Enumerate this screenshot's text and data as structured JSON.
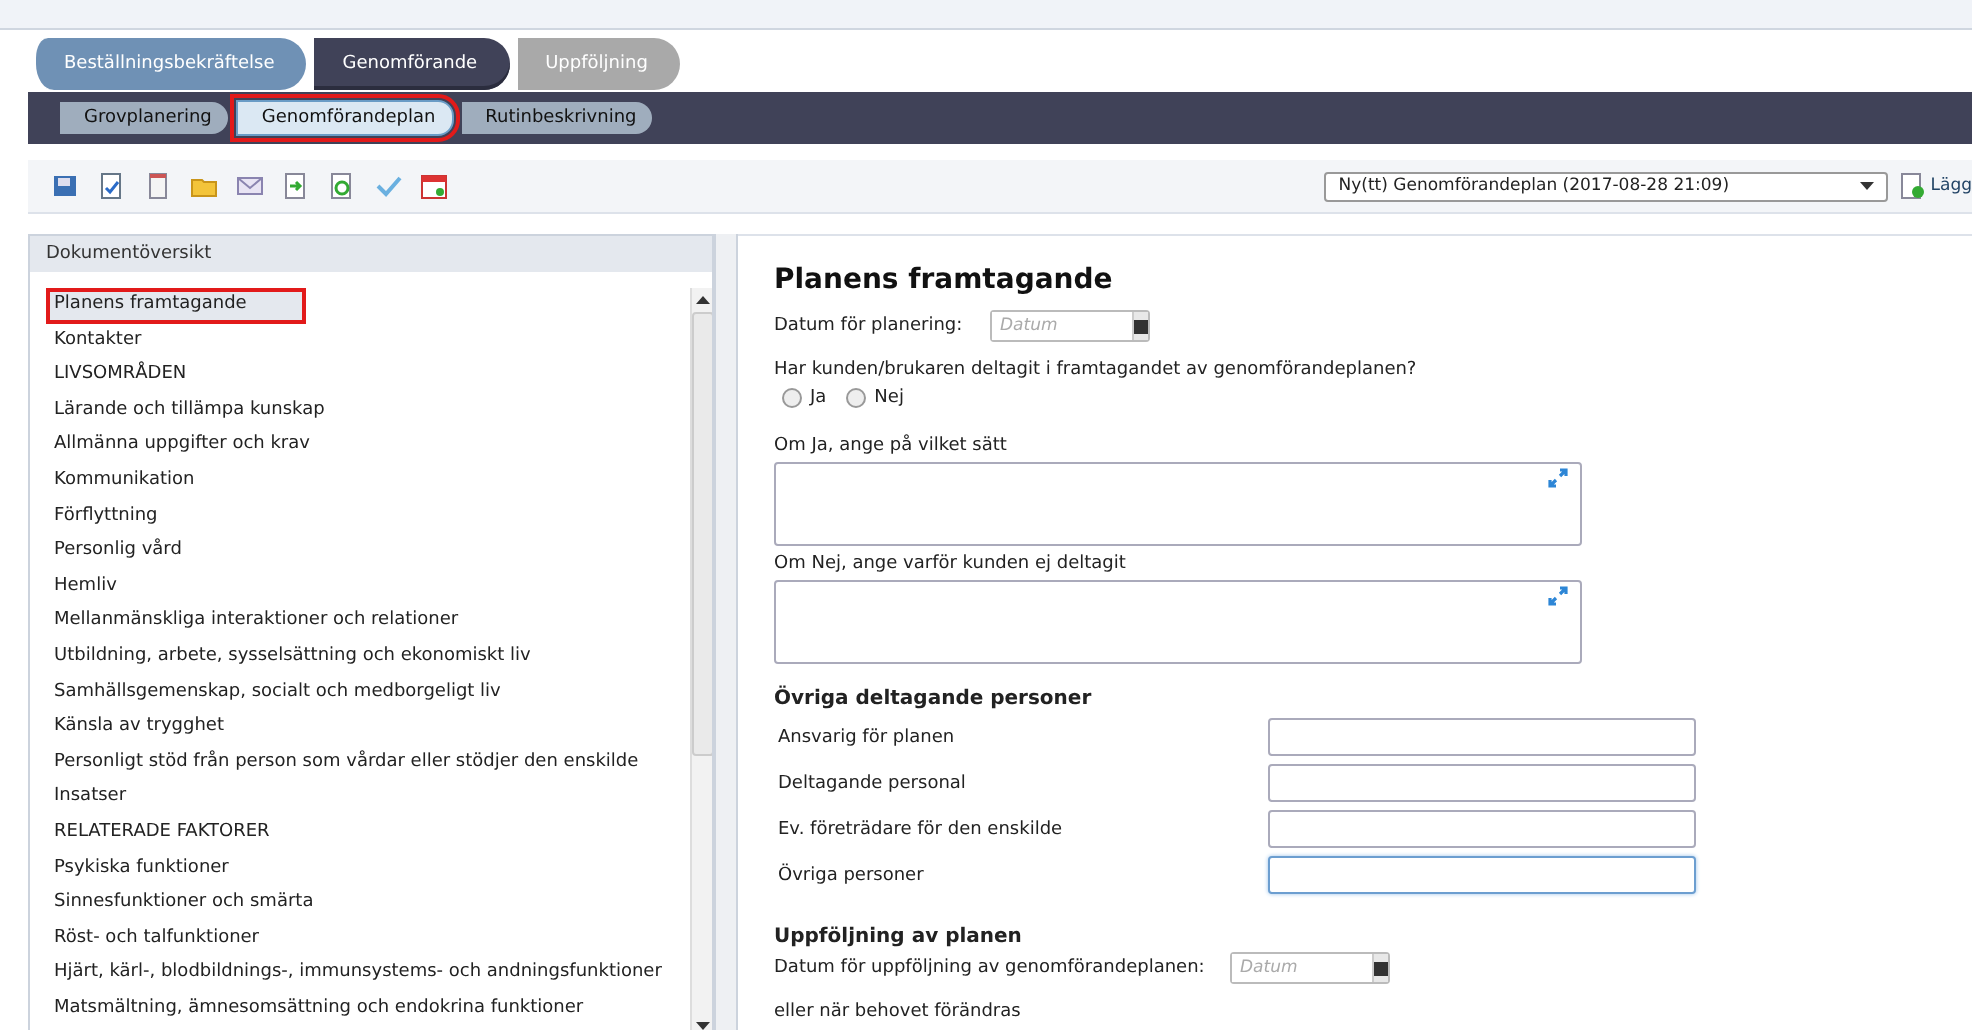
{
  "stage_tabs": [
    {
      "label": "Beställningsbekräftelse",
      "kind": "done",
      "selected": false
    },
    {
      "label": "Genomförande",
      "kind": "current",
      "selected": true
    },
    {
      "label": "Uppföljning",
      "kind": "upcoming",
      "selected": false
    }
  ],
  "sub_tabs": [
    {
      "label": "Grovplanering",
      "selected": false,
      "highlighted": false
    },
    {
      "label": "Genomförandeplan",
      "selected": true,
      "highlighted": true
    },
    {
      "label": "Rutinbeskrivning",
      "selected": false,
      "highlighted": false
    }
  ],
  "document_select": {
    "value": "Ny(tt) Genomförandeplan (2017-08-28 21:09)"
  },
  "add_button": {
    "label": "Lägg"
  },
  "sidebar": {
    "title": "Dokumentöversikt",
    "items": [
      {
        "label": "Planens framtagande",
        "selected": true,
        "highlighted": true
      },
      {
        "label": "Kontakter",
        "selected": false,
        "highlighted": false
      },
      {
        "label": "LIVSOMRÅDEN",
        "selected": false,
        "highlighted": false
      },
      {
        "label": "Lärande och tillämpa kunskap",
        "selected": false,
        "highlighted": false
      },
      {
        "label": "Allmänna uppgifter och krav",
        "selected": false,
        "highlighted": false
      },
      {
        "label": "Kommunikation",
        "selected": false,
        "highlighted": false
      },
      {
        "label": "Förflyttning",
        "selected": false,
        "highlighted": false
      },
      {
        "label": "Personlig vård",
        "selected": false,
        "highlighted": false
      },
      {
        "label": "Hemliv",
        "selected": false,
        "highlighted": false
      },
      {
        "label": "Mellanmänskliga interaktioner och relationer",
        "selected": false,
        "highlighted": false
      },
      {
        "label": "Utbildning, arbete, sysselsättning och ekonomiskt liv",
        "selected": false,
        "highlighted": false
      },
      {
        "label": "Samhällsgemenskap, socialt och medborgeligt liv",
        "selected": false,
        "highlighted": false
      },
      {
        "label": "Känsla av trygghet",
        "selected": false,
        "highlighted": false
      },
      {
        "label": "Personligt stöd från person som vårdar eller stödjer den enskilde",
        "selected": false,
        "highlighted": false
      },
      {
        "label": "Insatser",
        "selected": false,
        "highlighted": false
      },
      {
        "label": "RELATERADE FAKTORER",
        "selected": false,
        "highlighted": false
      },
      {
        "label": "Psykiska funktioner",
        "selected": false,
        "highlighted": false
      },
      {
        "label": "Sinnesfunktioner och smärta",
        "selected": false,
        "highlighted": false
      },
      {
        "label": "Röst- och talfunktioner",
        "selected": false,
        "highlighted": false
      },
      {
        "label": "Hjärt, kärl-, blodbildnings-, immunsystems- och andningsfunktioner",
        "selected": false,
        "highlighted": false
      },
      {
        "label": "Matsmältning, ämnesomsättning och endokrina funktioner",
        "selected": false,
        "highlighted": false
      }
    ]
  },
  "form": {
    "title": "Planens framtagande",
    "planning_date": {
      "label": "Datum för planering:",
      "placeholder": "Datum"
    },
    "question": "Har kunden/brukaren deltagit i framtagandet av genomförandeplanen?",
    "answers": [
      {
        "label": "Ja",
        "selected": false
      },
      {
        "label": "Nej",
        "selected": false
      }
    ],
    "text_areas": [
      {
        "label": "Om Ja, ange på vilket sätt"
      },
      {
        "label": "Om Nej, ange varför kunden ej deltagit"
      }
    ],
    "participants": {
      "title": "Övriga deltagande personer",
      "fields": [
        {
          "label": "Ansvarig för planen",
          "focused": false
        },
        {
          "label": "Deltagande personal",
          "focused": false
        },
        {
          "label": "Ev. företrädare för den enskilde",
          "focused": false
        },
        {
          "label": "Övriga personer",
          "focused": true
        }
      ]
    },
    "follow_up": {
      "title": "Uppföljning av planen",
      "date": {
        "label": "Datum för uppföljning av genomförandeplanen:",
        "placeholder": "Datum"
      },
      "note": "eller när behovet förändras"
    }
  }
}
